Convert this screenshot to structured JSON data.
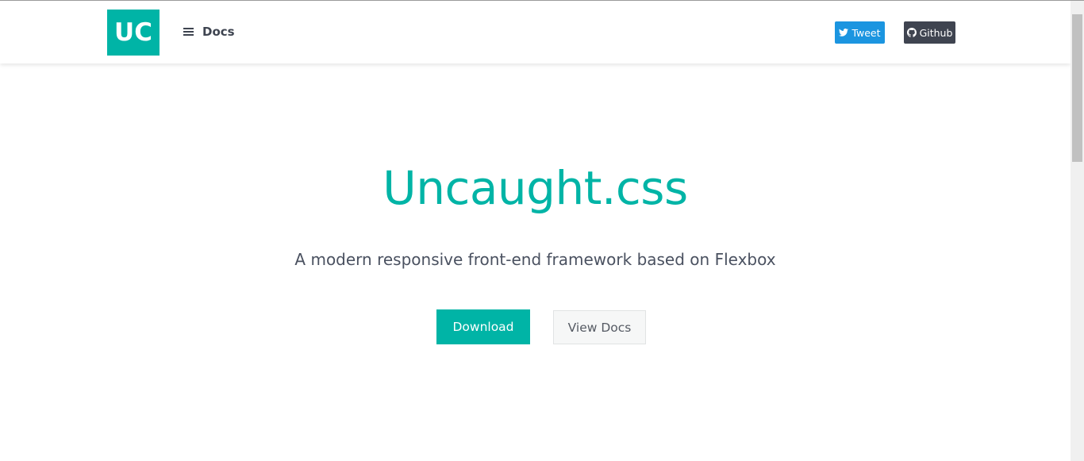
{
  "colors": {
    "brand": "#00b4a6",
    "tweet": "#1b95e0",
    "github": "#3f4450"
  },
  "navbar": {
    "logo_text": "UC",
    "docs_label": "Docs",
    "tweet_label": "Tweet",
    "github_label": "Github",
    "icons": {
      "menu": "hamburger-icon",
      "tweet": "twitter-icon",
      "github": "github-icon"
    }
  },
  "hero": {
    "title": "Uncaught.css",
    "subtitle": "A modern responsive front-end framework based on Flexbox",
    "download_label": "Download",
    "view_docs_label": "View Docs"
  }
}
